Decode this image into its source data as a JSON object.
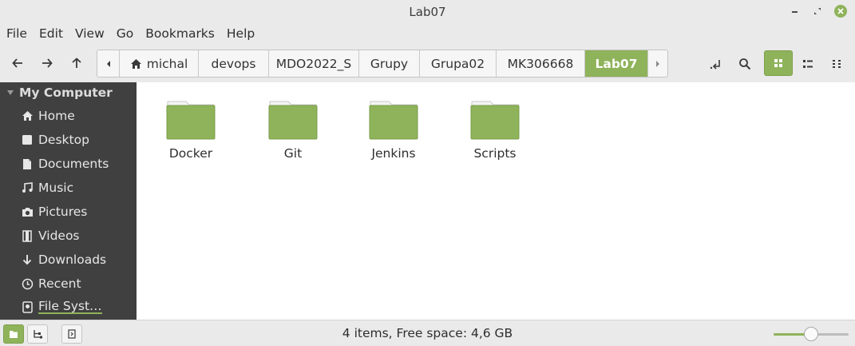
{
  "window": {
    "title": "Lab07"
  },
  "menu": [
    "File",
    "Edit",
    "View",
    "Go",
    "Bookmarks",
    "Help"
  ],
  "breadcrumbs": [
    "michal",
    "devops",
    "MDO2022_S",
    "Grupy",
    "Grupa02",
    "MK306668",
    "Lab07"
  ],
  "sidebar": {
    "section": "My Computer",
    "items": [
      {
        "label": "Home",
        "icon": "home-icon"
      },
      {
        "label": "Desktop",
        "icon": "desktop-icon"
      },
      {
        "label": "Documents",
        "icon": "documents-icon"
      },
      {
        "label": "Music",
        "icon": "music-icon"
      },
      {
        "label": "Pictures",
        "icon": "camera-icon"
      },
      {
        "label": "Videos",
        "icon": "film-icon"
      },
      {
        "label": "Downloads",
        "icon": "download-icon"
      },
      {
        "label": "Recent",
        "icon": "clock-icon"
      },
      {
        "label": "File Syst…",
        "icon": "drive-icon"
      }
    ]
  },
  "folders": [
    {
      "label": "Docker"
    },
    {
      "label": "Git"
    },
    {
      "label": "Jenkins"
    },
    {
      "label": "Scripts"
    }
  ],
  "status": {
    "text": "4 items, Free space: 4,6 GB",
    "zoom_level": 0.5
  },
  "colors": {
    "accent": "#8fb35a",
    "sidebar_bg": "#404040"
  }
}
